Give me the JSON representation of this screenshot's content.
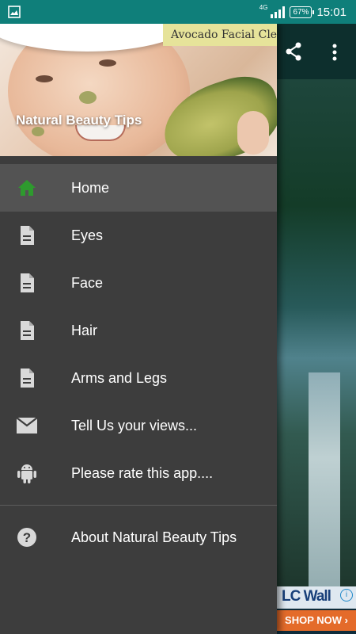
{
  "status_bar": {
    "network": "4G",
    "battery": "67%",
    "time": "15:01"
  },
  "drawer": {
    "header": {
      "banner_text": "Avocado Facial Clean",
      "title": "Natural Beauty Tips"
    },
    "items": [
      {
        "label": "Home",
        "icon": "home-icon",
        "active": true
      },
      {
        "label": "Eyes",
        "icon": "document-icon"
      },
      {
        "label": "Face",
        "icon": "document-icon"
      },
      {
        "label": "Hair",
        "icon": "document-icon"
      },
      {
        "label": "Arms and Legs",
        "icon": "document-icon"
      },
      {
        "label": "Tell Us your views...",
        "icon": "mail-icon"
      },
      {
        "label": "Please rate this app....",
        "icon": "android-icon"
      }
    ],
    "footer_items": [
      {
        "label": "About Natural Beauty Tips",
        "icon": "help-icon"
      }
    ]
  },
  "ad": {
    "brand": "LC Wall",
    "cta": "SHOP NOW ›"
  },
  "colors": {
    "status_bar": "#0f7f7a",
    "drawer_bg": "#3d3d3d",
    "active_item_bg": "#535353",
    "home_icon": "#2e9a2e"
  }
}
